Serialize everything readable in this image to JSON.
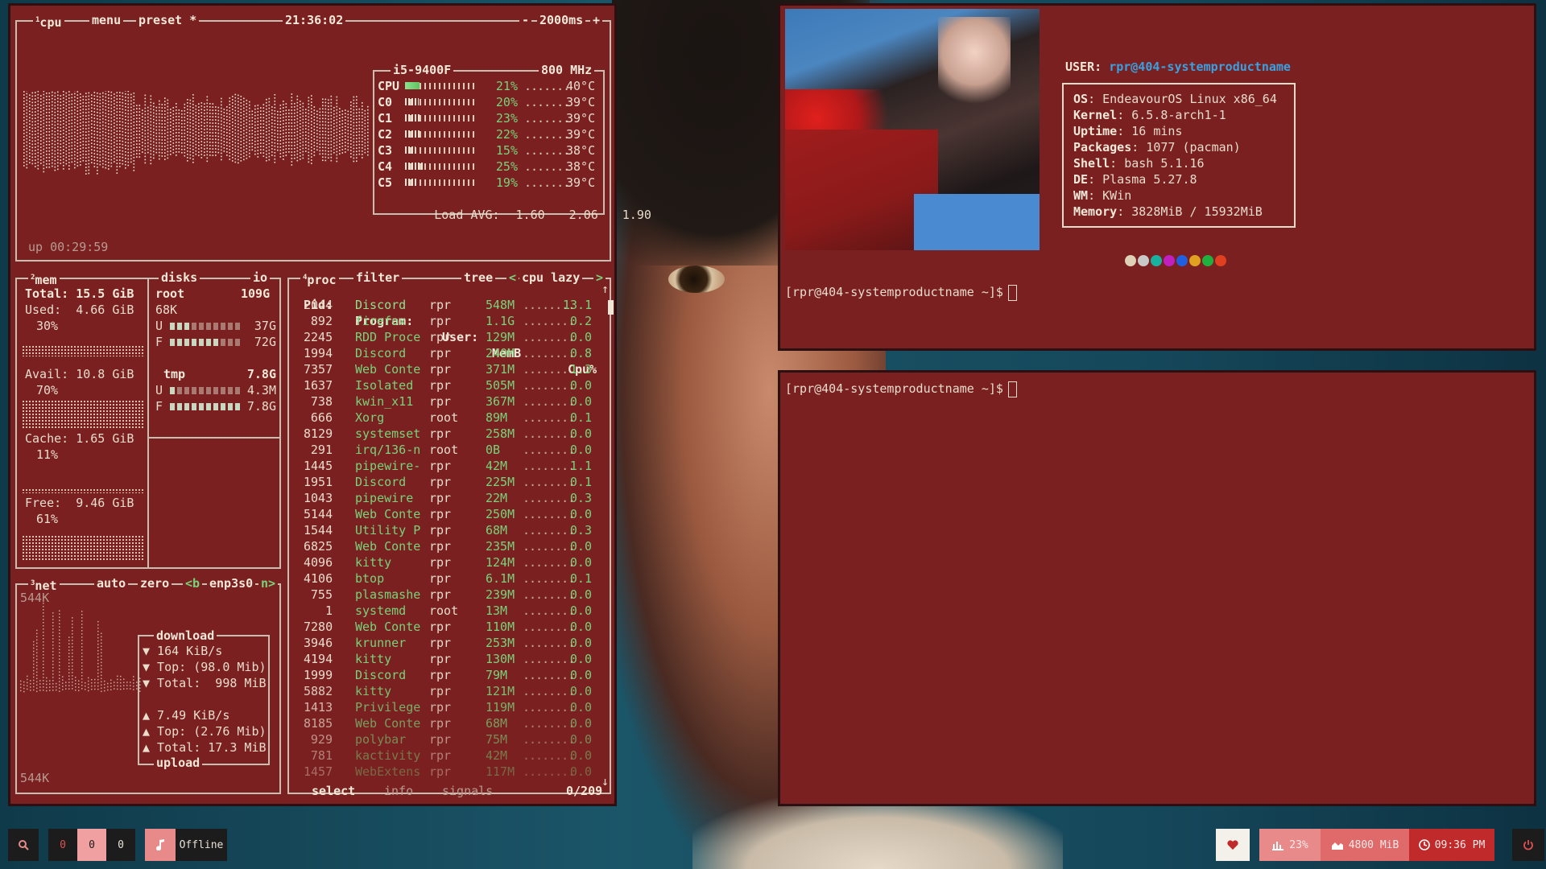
{
  "btop": {
    "cpu_box": {
      "tab_num": "1",
      "tab_label": "cpu",
      "menu": "menu",
      "preset": "preset *",
      "clock": "21:36:02",
      "interval_minus": "-",
      "interval": "2000ms",
      "interval_plus": "+",
      "cpu_name": "i5-9400F",
      "freq": "800 MHz",
      "uptime": "up 00:29:59",
      "rows": [
        {
          "label": "CPU",
          "pct": "21%",
          "temp": "40°C"
        },
        {
          "label": "C0",
          "pct": "20%",
          "temp": "39°C"
        },
        {
          "label": "C1",
          "pct": "23%",
          "temp": "39°C"
        },
        {
          "label": "C2",
          "pct": "22%",
          "temp": "39°C"
        },
        {
          "label": "C3",
          "pct": "15%",
          "temp": "38°C"
        },
        {
          "label": "C4",
          "pct": "25%",
          "temp": "38°C"
        },
        {
          "label": "C5",
          "pct": "19%",
          "temp": "39°C"
        }
      ],
      "load_label": "Load AVG:",
      "load": [
        "1.60",
        "2.06",
        "1.90"
      ]
    },
    "mem_box": {
      "tab_num": "2",
      "tab_label": "mem",
      "total_label": "Total:",
      "total": "15.5 GiB",
      "used_label": "Used:",
      "used": "4.66 GiB",
      "used_pct": "30%",
      "avail_label": "Avail:",
      "avail": "10.8 GiB",
      "avail_pct": "70%",
      "cache_label": "Cache:",
      "cache": "1.65 GiB",
      "cache_pct": "11%",
      "free_label": "Free:",
      "free": "9.46 GiB",
      "free_pct": "61%"
    },
    "disks_box": {
      "tab_label": "disks",
      "io_label": "io",
      "root_name": "root",
      "root_size": "109G",
      "root_io": "68K",
      "root_u_label": "U",
      "root_u": "37G",
      "root_f_label": "F",
      "root_f": "72G",
      "tmp_name": "tmp",
      "tmp_size": "7.8G",
      "tmp_u_label": "U",
      "tmp_u": "4.3M",
      "tmp_f_label": "F",
      "tmp_f": "7.8G"
    },
    "net_box": {
      "tab_num": "3",
      "tab_label": "net",
      "auto": "auto",
      "zero": "zero",
      "prev": "<b",
      "iface": "enp3s0",
      "next": "n>",
      "scale_top": "544K",
      "scale_bottom": "544K",
      "download_title": "download",
      "dl_rate": "▼ 164 KiB/s",
      "dl_top": "▼ Top: (98.0 Mib)",
      "dl_total": "▼ Total:  998 MiB",
      "ul_rate": "▲ 7.49 KiB/s",
      "ul_top": "▲ Top: (2.76 Mib)",
      "ul_total": "▲ Total: 17.3 MiB",
      "upload_title": "upload"
    },
    "proc_box": {
      "tab_num": "4",
      "tab_label": "proc",
      "filter": "filter",
      "tree": "tree",
      "sort_prev": "<",
      "sort": "cpu lazy",
      "sort_next": ">",
      "headers": {
        "pid": "Pid:",
        "program": "Program:",
        "user": "User:",
        "mem": "MemB",
        "cpu": "Cpu%"
      },
      "rows": [
        {
          "pid": "2044",
          "prog": "Discord",
          "user": "rpr",
          "mem": "548M",
          "cpu": "13.1"
        },
        {
          "pid": "892",
          "prog": "firefox",
          "user": "rpr",
          "mem": "1.1G",
          "cpu": "0.2"
        },
        {
          "pid": "2245",
          "prog": "RDD Proce",
          "user": "rpr",
          "mem": "129M",
          "cpu": "0.0"
        },
        {
          "pid": "1994",
          "prog": "Discord",
          "user": "rpr",
          "mem": "240M",
          "cpu": "0.8"
        },
        {
          "pid": "7357",
          "prog": "Web Conte",
          "user": "rpr",
          "mem": "371M",
          "cpu": "1.3"
        },
        {
          "pid": "1637",
          "prog": "Isolated",
          "user": "rpr",
          "mem": "505M",
          "cpu": "0.0"
        },
        {
          "pid": "738",
          "prog": "kwin_x11",
          "user": "rpr",
          "mem": "367M",
          "cpu": "0.0"
        },
        {
          "pid": "666",
          "prog": "Xorg",
          "user": "root",
          "mem": "89M",
          "cpu": "0.1"
        },
        {
          "pid": "8129",
          "prog": "systemset",
          "user": "rpr",
          "mem": "258M",
          "cpu": "0.0"
        },
        {
          "pid": "291",
          "prog": "irq/136-n",
          "user": "root",
          "mem": "0B",
          "cpu": "0.0"
        },
        {
          "pid": "1445",
          "prog": "pipewire-",
          "user": "rpr",
          "mem": "42M",
          "cpu": "1.1"
        },
        {
          "pid": "1951",
          "prog": "Discord",
          "user": "rpr",
          "mem": "225M",
          "cpu": "0.1"
        },
        {
          "pid": "1043",
          "prog": "pipewire",
          "user": "rpr",
          "mem": "22M",
          "cpu": "0.3"
        },
        {
          "pid": "5144",
          "prog": "Web Conte",
          "user": "rpr",
          "mem": "250M",
          "cpu": "0.0"
        },
        {
          "pid": "1544",
          "prog": "Utility P",
          "user": "rpr",
          "mem": "68M",
          "cpu": "0.3"
        },
        {
          "pid": "6825",
          "prog": "Web Conte",
          "user": "rpr",
          "mem": "235M",
          "cpu": "0.0"
        },
        {
          "pid": "4096",
          "prog": "kitty",
          "user": "rpr",
          "mem": "124M",
          "cpu": "0.0"
        },
        {
          "pid": "4106",
          "prog": "btop",
          "user": "rpr",
          "mem": "6.1M",
          "cpu": "0.1"
        },
        {
          "pid": "755",
          "prog": "plasmashe",
          "user": "rpr",
          "mem": "239M",
          "cpu": "0.0"
        },
        {
          "pid": "1",
          "prog": "systemd",
          "user": "root",
          "mem": "13M",
          "cpu": "0.0"
        },
        {
          "pid": "7280",
          "prog": "Web Conte",
          "user": "rpr",
          "mem": "110M",
          "cpu": "0.0"
        },
        {
          "pid": "3946",
          "prog": "krunner",
          "user": "rpr",
          "mem": "253M",
          "cpu": "0.0"
        },
        {
          "pid": "4194",
          "prog": "kitty",
          "user": "rpr",
          "mem": "130M",
          "cpu": "0.0"
        },
        {
          "pid": "1999",
          "prog": "Discord",
          "user": "rpr",
          "mem": "79M",
          "cpu": "0.0"
        },
        {
          "pid": "5882",
          "prog": "kitty",
          "user": "rpr",
          "mem": "121M",
          "cpu": "0.0"
        },
        {
          "pid": "1413",
          "prog": "Privilege",
          "user": "rpr",
          "mem": "119M",
          "cpu": "0.0"
        },
        {
          "pid": "8185",
          "prog": "Web Conte",
          "user": "rpr",
          "mem": "68M",
          "cpu": "0.0"
        },
        {
          "pid": "929",
          "prog": "polybar",
          "user": "rpr",
          "mem": "75M",
          "cpu": "0.0"
        },
        {
          "pid": "781",
          "prog": "kactivity",
          "user": "rpr",
          "mem": "42M",
          "cpu": "0.0"
        },
        {
          "pid": "1457",
          "prog": "WebExtens",
          "user": "rpr",
          "mem": "117M",
          "cpu": "0.0"
        }
      ],
      "footer_select": "select",
      "footer_info": "info",
      "footer_signals": "signals",
      "footer_count": "0/209",
      "scroll_up": "↑",
      "scroll_down": "↓"
    }
  },
  "fetch": {
    "user_label": "USER:",
    "user": "rpr@404-systemproductname",
    "lines": [
      {
        "k": "OS",
        "v": "EndeavourOS Linux x86_64"
      },
      {
        "k": "Kernel",
        "v": "6.5.8-arch1-1"
      },
      {
        "k": "Uptime",
        "v": "16 mins"
      },
      {
        "k": "Packages",
        "v": "1077 (pacman)"
      },
      {
        "k": "Shell",
        "v": "bash 5.1.16"
      },
      {
        "k": "DE",
        "v": "Plasma 5.27.8"
      },
      {
        "k": "WM",
        "v": "KWin"
      },
      {
        "k": "Memory",
        "v": "3828MiB / 15932MiB"
      }
    ],
    "palette": [
      "#e0d0b8",
      "#c8c8c8",
      "#1ab0a0",
      "#c020c0",
      "#2060e0",
      "#e0a020",
      "#20b040",
      "#e04020"
    ],
    "prompt": "[rpr@404-systemproductname ~]$"
  },
  "terminal2": {
    "prompt": "[rpr@404-systemproductname ~]$"
  },
  "taskbar": {
    "ws": [
      "0",
      "0",
      "0"
    ],
    "music_status": "Offline",
    "cpu": "23%",
    "mem": "4800 MiB",
    "clock": "09:36 PM",
    "colors": {
      "dark": "#1c1c1c",
      "pink": "#e98a8a",
      "active_pink": "#f0a0a0",
      "red": "#c02a2a",
      "white": "#f4f0ea"
    }
  }
}
